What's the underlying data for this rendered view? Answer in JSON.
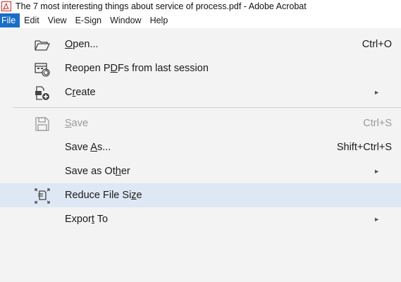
{
  "window": {
    "title": "The 7 most interesting things about service of process.pdf - Adobe Acrobat"
  },
  "menubar": {
    "items": [
      {
        "label": "File",
        "active": true
      },
      {
        "label": "Edit"
      },
      {
        "label": "View"
      },
      {
        "label": "E-Sign"
      },
      {
        "label": "Window"
      },
      {
        "label": "Help"
      }
    ]
  },
  "file_menu": {
    "items": [
      {
        "pre": "",
        "key": "O",
        "post": "pen...",
        "shortcut": "Ctrl+O",
        "icon": "open-folder-icon"
      },
      {
        "pre": "Reopen P",
        "key": "D",
        "post": "Fs from last session",
        "icon": "reopen-icon"
      },
      {
        "pre": "C",
        "key": "r",
        "post": "eate",
        "icon": "create-icon",
        "submenu": true
      },
      {
        "pre": "",
        "key": "S",
        "post": "ave",
        "shortcut": "Ctrl+S",
        "icon": "save-icon",
        "disabled": true
      },
      {
        "pre": "Save ",
        "key": "A",
        "post": "s...",
        "shortcut": "Shift+Ctrl+S"
      },
      {
        "pre": "Save as Ot",
        "key": "h",
        "post": "er",
        "submenu": true
      },
      {
        "pre": "Reduce File Si",
        "key": "z",
        "post": "e",
        "icon": "reduce-file-size-icon",
        "highlighted": true
      },
      {
        "pre": "Expor",
        "key": "t",
        "post": " To",
        "submenu": true
      }
    ],
    "submenu_arrow": "►"
  },
  "colors": {
    "menu_active": "#1a6ec8",
    "menu_background": "#f3f3f3",
    "highlight": "#dde8f4",
    "pdf_icon_red": "#d9241c"
  }
}
